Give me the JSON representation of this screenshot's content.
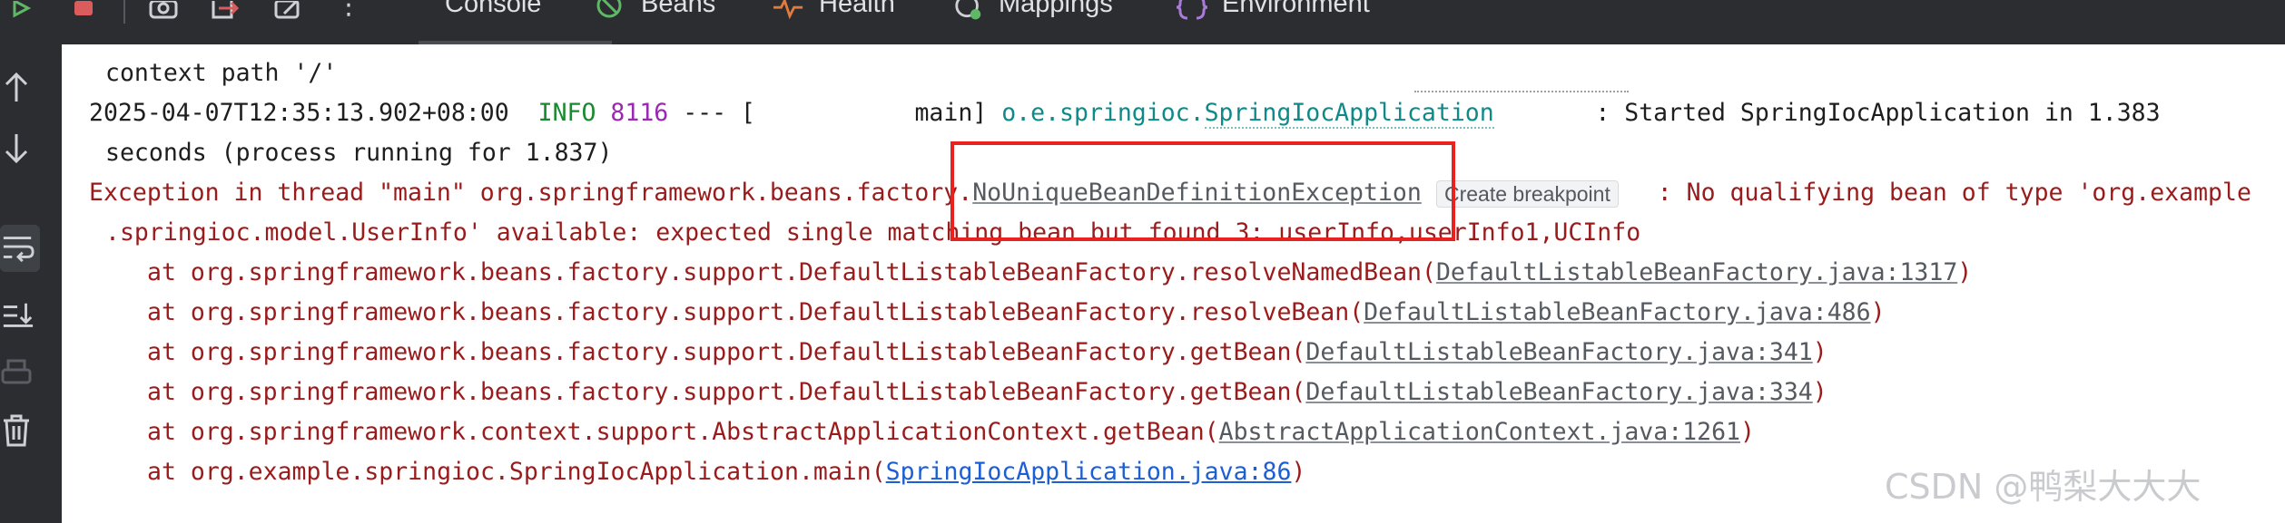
{
  "toolbar": {
    "tabs": [
      {
        "label": "Console",
        "icon": "console-icon"
      },
      {
        "label": "Beans",
        "icon": "beans-icon"
      },
      {
        "label": "Health",
        "icon": "health-icon"
      },
      {
        "label": "Mappings",
        "icon": "mappings-icon"
      },
      {
        "label": "Environment",
        "icon": "environment-icon"
      }
    ],
    "more": "⋮"
  },
  "console": {
    "line1": "context path '/'",
    "line2": {
      "timestamp": "2025-04-07T12:35:13.902+08:00",
      "level": "INFO",
      "pid": "8116",
      "sep": " --- [",
      "thread": "           main]",
      "logger_prefix": "o.e.springioc.",
      "logger_class": "SpringIocApplication",
      "message": "       : Started SpringIocApplication in 1.383"
    },
    "line3": "seconds (process running for 1.837)",
    "line4": {
      "prefix": "Exception in thread \"main\" org.springframework.beans.factory.",
      "exception": "NoUniqueBeanDefinitionException",
      "suffix": " : No qualifying bean of type 'org.example"
    },
    "line5": ".springioc.model.UserInfo' available: expected single matching bean but found 3: userInfo,userInfo1,UCInfo",
    "stack": [
      {
        "text": "at org.springframework.beans.factory.support.DefaultListableBeanFactory.resolveNamedBean(",
        "link": "DefaultListableBeanFactory.java:1317",
        "end": ")"
      },
      {
        "text": "at org.springframework.beans.factory.support.DefaultListableBeanFactory.resolveBean(",
        "link": "DefaultListableBeanFactory.java:486",
        "end": ")"
      },
      {
        "text": "at org.springframework.beans.factory.support.DefaultListableBeanFactory.getBean(",
        "link": "DefaultListableBeanFactory.java:341",
        "end": ")"
      },
      {
        "text": "at org.springframework.beans.factory.support.DefaultListableBeanFactory.getBean(",
        "link": "DefaultListableBeanFactory.java:334",
        "end": ")"
      },
      {
        "text": "at org.springframework.context.support.AbstractApplicationContext.getBean(",
        "link": "AbstractApplicationContext.java:1261",
        "end": ")"
      },
      {
        "text": "at org.example.springioc.SpringIocApplication.main(",
        "link": "SpringIocApplication.java:86",
        "end": ")"
      }
    ]
  },
  "tooltip": "Create breakpoint",
  "watermark": "CSDN @鸭梨大大大",
  "colors": {
    "toolbar_bg": "#2b2d30",
    "error_text": "#9a1b1b",
    "info_green": "#1a8a2e",
    "pid_purple": "#9c27b0",
    "logger_teal": "#0f8a8a",
    "highlight_box": "#e8231f"
  }
}
